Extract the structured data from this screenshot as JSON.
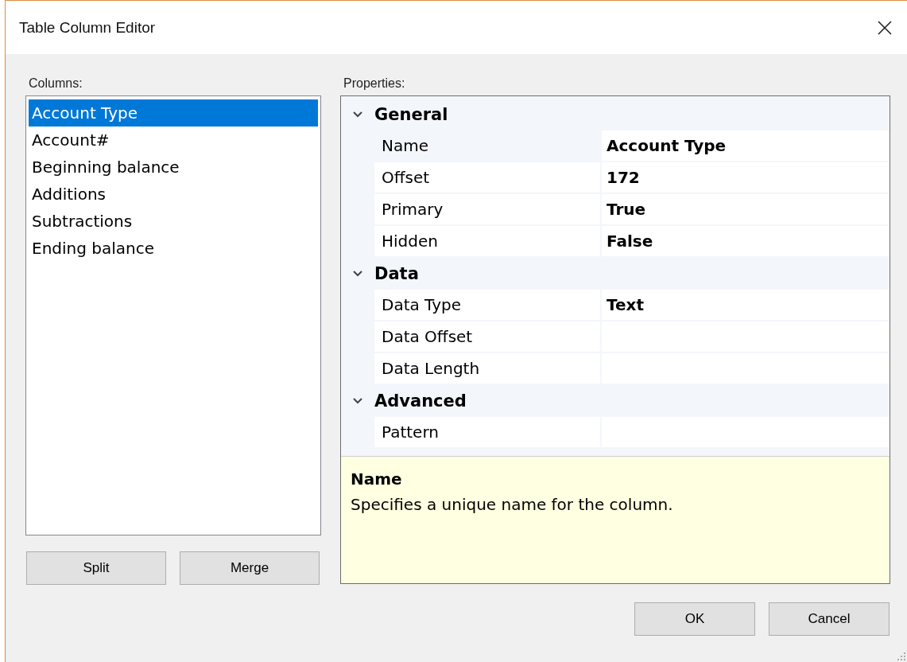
{
  "window": {
    "title": "Table Column Editor"
  },
  "columns": {
    "label": "Columns:",
    "items": [
      {
        "name": "Account Type",
        "selected": true
      },
      {
        "name": "Account#",
        "selected": false
      },
      {
        "name": "Beginning balance",
        "selected": false
      },
      {
        "name": "Additions",
        "selected": false
      },
      {
        "name": "Subtractions",
        "selected": false
      },
      {
        "name": "Ending balance",
        "selected": false
      }
    ]
  },
  "column_buttons": [
    "Split",
    "Merge"
  ],
  "properties": {
    "label": "Properties:",
    "categories": [
      {
        "name": "General",
        "expanded": true,
        "rows": [
          {
            "name": "Name",
            "value": "Account Type",
            "selected": true
          },
          {
            "name": "Offset",
            "value": "172",
            "selected": false
          },
          {
            "name": "Primary",
            "value": "True",
            "selected": false
          },
          {
            "name": "Hidden",
            "value": "False",
            "selected": false
          }
        ]
      },
      {
        "name": "Data",
        "expanded": true,
        "rows": [
          {
            "name": "Data Type",
            "value": "Text",
            "selected": false
          },
          {
            "name": "Data Offset",
            "selected": false
          },
          {
            "name": "Data Length",
            "selected": false
          }
        ]
      },
      {
        "name": "Advanced",
        "expanded": true,
        "rows": [
          {
            "name": "Pattern",
            "selected": false
          }
        ]
      }
    ],
    "description": {
      "title": "Name",
      "text": "Specifies a unique name for the column."
    }
  },
  "buttons": [
    "OK",
    "Cancel"
  ]
}
